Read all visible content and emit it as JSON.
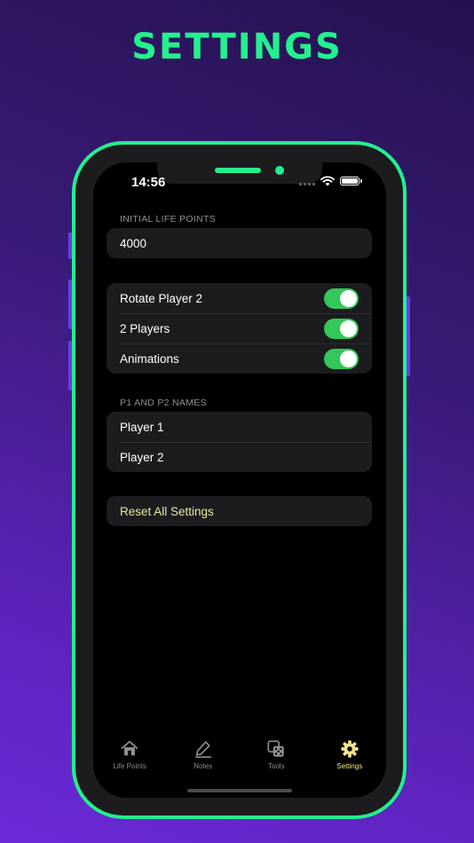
{
  "headline": "SETTINGS",
  "status": {
    "time": "14:56"
  },
  "sections": {
    "life_points": {
      "header": "INITIAL LIFE POINTS",
      "value": "4000"
    },
    "toggles": [
      {
        "label": "Rotate Player 2",
        "on": true
      },
      {
        "label": "2 Players",
        "on": true
      },
      {
        "label": "Animations",
        "on": true
      }
    ],
    "names": {
      "header": "P1 AND P2 NAMES",
      "player1": "Player 1",
      "player2": "Player 2"
    },
    "reset": {
      "label": "Reset All Settings"
    }
  },
  "tabs": [
    {
      "label": "Life Points",
      "icon": "house-icon",
      "active": false
    },
    {
      "label": "Notes",
      "icon": "pencil-icon",
      "active": false
    },
    {
      "label": "Tools",
      "icon": "dice-icon",
      "active": false
    },
    {
      "label": "Settings",
      "icon": "gear-icon",
      "active": true
    }
  ],
  "colors": {
    "accent_green": "#23f08e",
    "toggle_on": "#34c759",
    "active_tab": "#f2e68c",
    "reset_text": "#e8e6a0"
  }
}
